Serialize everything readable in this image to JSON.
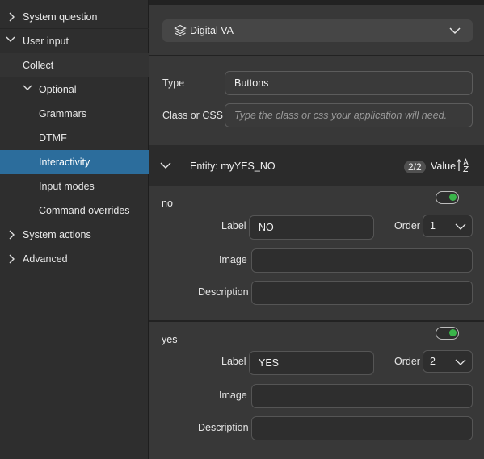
{
  "sidebar": {
    "items": [
      {
        "label": "System question"
      },
      {
        "label": "User input"
      },
      {
        "label": "Collect"
      },
      {
        "label": "Optional"
      },
      {
        "label": "Grammars"
      },
      {
        "label": "DTMF"
      },
      {
        "label": "Interactivity"
      },
      {
        "label": "Input modes"
      },
      {
        "label": "Command overrides"
      },
      {
        "label": "System actions"
      },
      {
        "label": "Advanced"
      }
    ],
    "selected": "Interactivity"
  },
  "va_selector": {
    "label": "Digital VA",
    "icon": "layers-icon"
  },
  "form": {
    "type_label": "Type",
    "type_value": "Buttons",
    "css_label": "Class or CSS",
    "css_placeholder": "Type the class or css your application will need."
  },
  "entity": {
    "label": "Entity: myYES_NO",
    "badge": "2/2",
    "sort_label": "Value",
    "sort_icon": "sort-alpha-icon"
  },
  "options": [
    {
      "key": "no",
      "toggle_on": true,
      "label_label": "Label",
      "label_value": "NO",
      "order_label": "Order",
      "order_value": "1",
      "image_label": "Image",
      "image_value": "",
      "description_label": "Description",
      "description_value": ""
    },
    {
      "key": "yes",
      "toggle_on": true,
      "label_label": "Label",
      "label_value": "YES",
      "order_label": "Order",
      "order_value": "2",
      "image_label": "Image",
      "image_value": "",
      "description_label": "Description",
      "description_value": ""
    }
  ],
  "colors": {
    "selected_bg": "#2c6d9c",
    "toggle_on": "#3ab54a"
  }
}
